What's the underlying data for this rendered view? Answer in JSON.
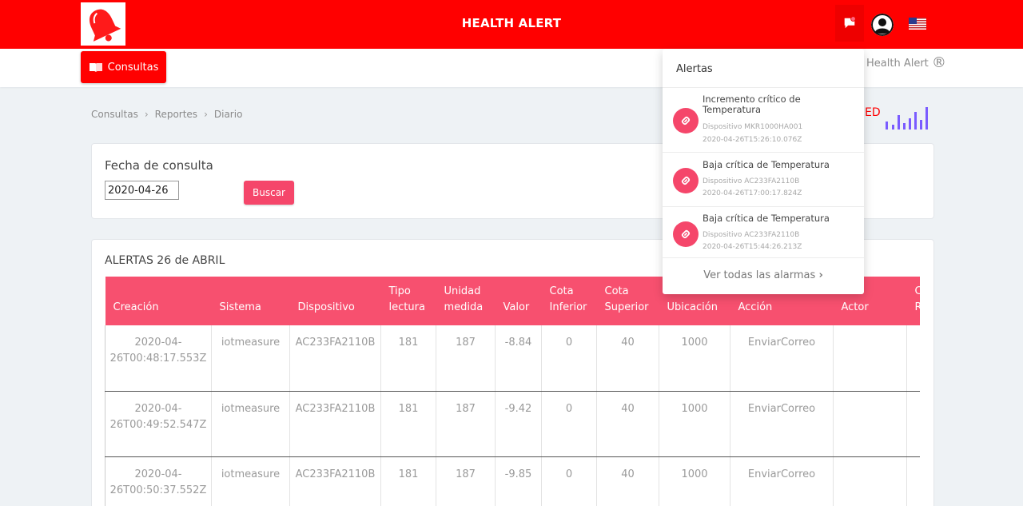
{
  "header": {
    "title": "HEALTH ALERT",
    "brand_color": "#ff0000"
  },
  "subnav": {
    "consultas_label": "Consultas",
    "brand_right": "Health Alert",
    "brand_reg": "®"
  },
  "breadcrumb": [
    "Consultas",
    "Reportes",
    "Diario"
  ],
  "partial_text": "ED",
  "fecha": {
    "label": "Fecha de consulta",
    "value": "2020-04-26",
    "button": "Buscar"
  },
  "table": {
    "title": "ALERTAS 26 de ABRIL",
    "header_color": "#f7506f",
    "columns": [
      "Creación",
      "Sistema",
      "Dispositivo",
      "Tipo lectura",
      "Unidad medida",
      "Valor",
      "Cota Inferior",
      "Cota Superior",
      "Ubicación",
      "Acción",
      "Actor",
      "C R"
    ],
    "rows": [
      [
        "2020-04-26T00:48:17.553Z",
        "iotmeasure",
        "AC233FA2110B",
        "181",
        "187",
        "-8.84",
        "0",
        "40",
        "1000",
        "EnviarCorreo",
        "",
        ""
      ],
      [
        "2020-04-26T00:49:52.547Z",
        "iotmeasure",
        "AC233FA2110B",
        "181",
        "187",
        "-9.42",
        "0",
        "40",
        "1000",
        "EnviarCorreo",
        "",
        ""
      ],
      [
        "2020-04-26T00:50:37.552Z",
        "iotmeasure",
        "AC233FA2110B",
        "181",
        "187",
        "-9.85",
        "0",
        "40",
        "1000",
        "EnviarCorreo",
        "",
        ""
      ]
    ]
  },
  "alerts": {
    "header": "Alertas",
    "items": [
      {
        "title": "Incremento crítico de Temperatura",
        "device": "Dispositivo MKR1000HA001",
        "time": "2020-04-26T15:26:10.076Z"
      },
      {
        "title": "Baja crítica de Temperatura",
        "device": "Dispositivo AC233FA2110B",
        "time": "2020-04-26T17:00:17.824Z"
      },
      {
        "title": "Baja crítica de Temperatura",
        "device": "Dispositivo AC233FA2110B",
        "time": "2020-04-26T15:44:26.213Z"
      }
    ],
    "footer": "Ver todas las alarmas",
    "icon_color": "#f5466a"
  },
  "icons": {
    "logo": "bell-logo-icon",
    "notifications": "chat-flag-icon",
    "user": "user-avatar-icon",
    "language": "us-flag-icon",
    "consultas": "book-icon",
    "alert_item": "link-icon",
    "stats": "signal-bars-icon"
  }
}
